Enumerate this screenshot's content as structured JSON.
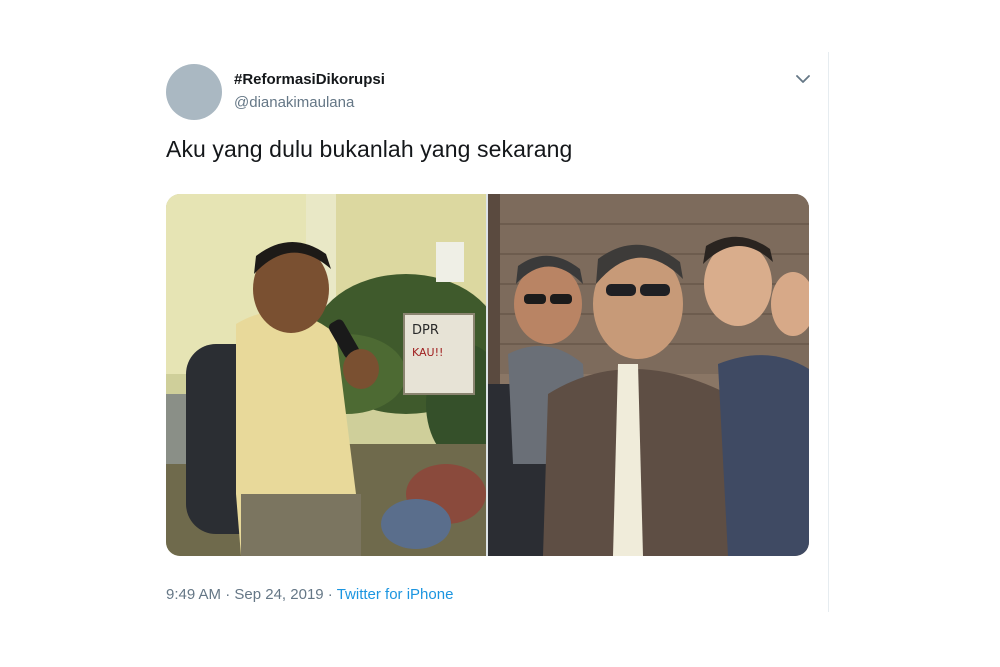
{
  "tweet": {
    "display_name": "#ReformasiDikorupsi",
    "handle": "@dianakimaulana",
    "text": "Aku yang dulu bukanlah yang sekarang",
    "time": "9:49 AM",
    "separator": " · ",
    "date": "Sep 24, 2019",
    "source": "Twitter for iPhone",
    "photos": {
      "left_sign_text": "DPR KAU!!",
      "count": 2
    }
  },
  "icons": {
    "menu": "chevron-down-icon",
    "avatar": "avatar-placeholder"
  },
  "colors": {
    "text_primary": "#14171a",
    "text_secondary": "#657786",
    "link": "#1b95e0",
    "avatar_bg": "#aab8c2",
    "border": "#e6ecf0"
  }
}
